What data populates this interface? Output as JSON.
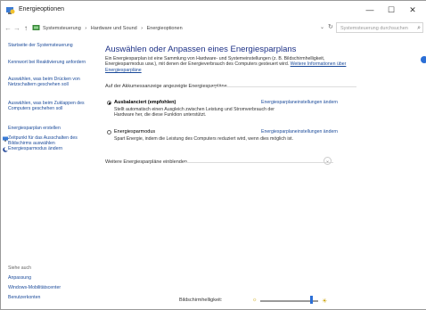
{
  "window": {
    "title": "Energieoptionen"
  },
  "titlebar": {
    "minimize": "—",
    "maximize": "☐",
    "close": "✕"
  },
  "address": {
    "back": "←",
    "forward": "→",
    "up": "↑",
    "crumbs": [
      "Systemsteuerung",
      "›",
      "Hardware und Sound",
      "›",
      "Energieoptionen"
    ],
    "dropdown": "⌄",
    "refresh": "↻",
    "search_placeholder": "Systemsteuerung durchsuchen",
    "search_icon": "⌕"
  },
  "sidebar": {
    "links": [
      "Startseite der Systemsteuerung",
      "Kennwort bei Reaktivierung anfordern",
      "Auswählen, was beim Drücken von Netzschaltern geschehen soll",
      "Auswählen, was beim Zuklappen des Computers geschehen soll",
      "Energiesparplan erstellen",
      "Zeitpunkt für das Ausschalten des Bildschirms auswählen",
      "Energiesparmodus ändern"
    ],
    "see_also": "Siehe auch",
    "bottom_links": [
      "Anpassung",
      "Windows-Mobilitätscenter",
      "Benutzerkonten"
    ]
  },
  "main": {
    "heading": "Auswählen oder Anpassen eines Energiesparplans",
    "description": "Ein Energiesparplan ist eine Sammlung von Hardware- und Systemeinstellungen (z. B. Bildschirmhelligkeit, Energiesparmodus usw.), mit denen der Energieverbrauch des Computers gesteuert wird.",
    "more_info_link": "Weitere Informationen über Energiesparpläne",
    "section_label": "Auf der Akkumessanzeige angezeigte Energiesparpläne",
    "plans": [
      {
        "name": "Ausbalanciert (empfohlen)",
        "selected": true,
        "description": "Stellt automatisch einen Ausgleich zwischen Leistung und Stromverbrauch der Hardware her, die diese Funktion unterstützt.",
        "settings_link": "Energiesparplaneinstellungen ändern"
      },
      {
        "name": "Energiesparmodus",
        "selected": false,
        "description": "Spart Energie, indem die Leistung des Computers reduziert wird, wenn dies möglich ist.",
        "settings_link": "Energiesparplaneinstellungen ändern"
      }
    ],
    "more_plans": "Weitere Energiesparpläne einblenden",
    "more_plans_icon": "⌄"
  },
  "brightness": {
    "label": "Bildschirmhelligkeit:",
    "value_fraction": 0.88
  },
  "colors": {
    "heading": "#1e3287",
    "link": "#1a4a9a",
    "accent": "#2b6fd6"
  }
}
